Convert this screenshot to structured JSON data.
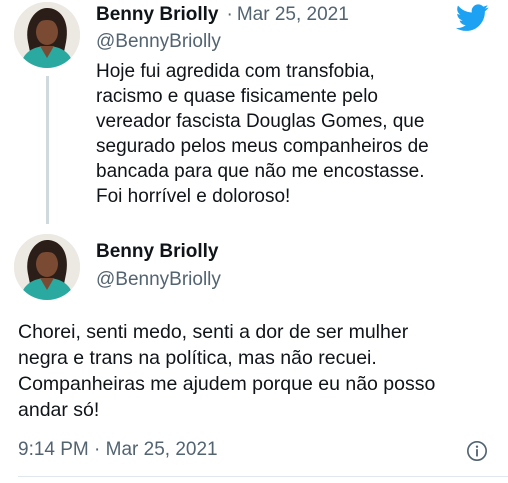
{
  "tweet1": {
    "author_name": "Benny Briolly",
    "separator": "·",
    "date": "Mar 25, 2021",
    "handle": "@BennyBriolly",
    "text": "Hoje fui agredida com transfobia,\nracismo e quase fisicamente pelo\nvereador fascista Douglas Gomes, que\nsegurado pelos meus companheiros de\nbancada para que não me encostasse.\nFoi horrível e doloroso!"
  },
  "tweet2": {
    "author_name": "Benny Briolly",
    "handle": "@BennyBriolly",
    "text": "Chorei, senti medo, senti a dor de ser mulher\nnegra e trans na política, mas não recuei.\nCompanheiras me ajudem porque eu não posso\nandar só!",
    "timestamp": "9:14 PM · Mar 25, 2021"
  },
  "icons": {
    "brand": "twitter-bird-icon",
    "info": "info-circle-icon"
  },
  "colors": {
    "twitter_blue": "#1da1f2",
    "text_primary": "#0f1419",
    "text_secondary": "#536471",
    "thread_line": "#cfd9de"
  }
}
